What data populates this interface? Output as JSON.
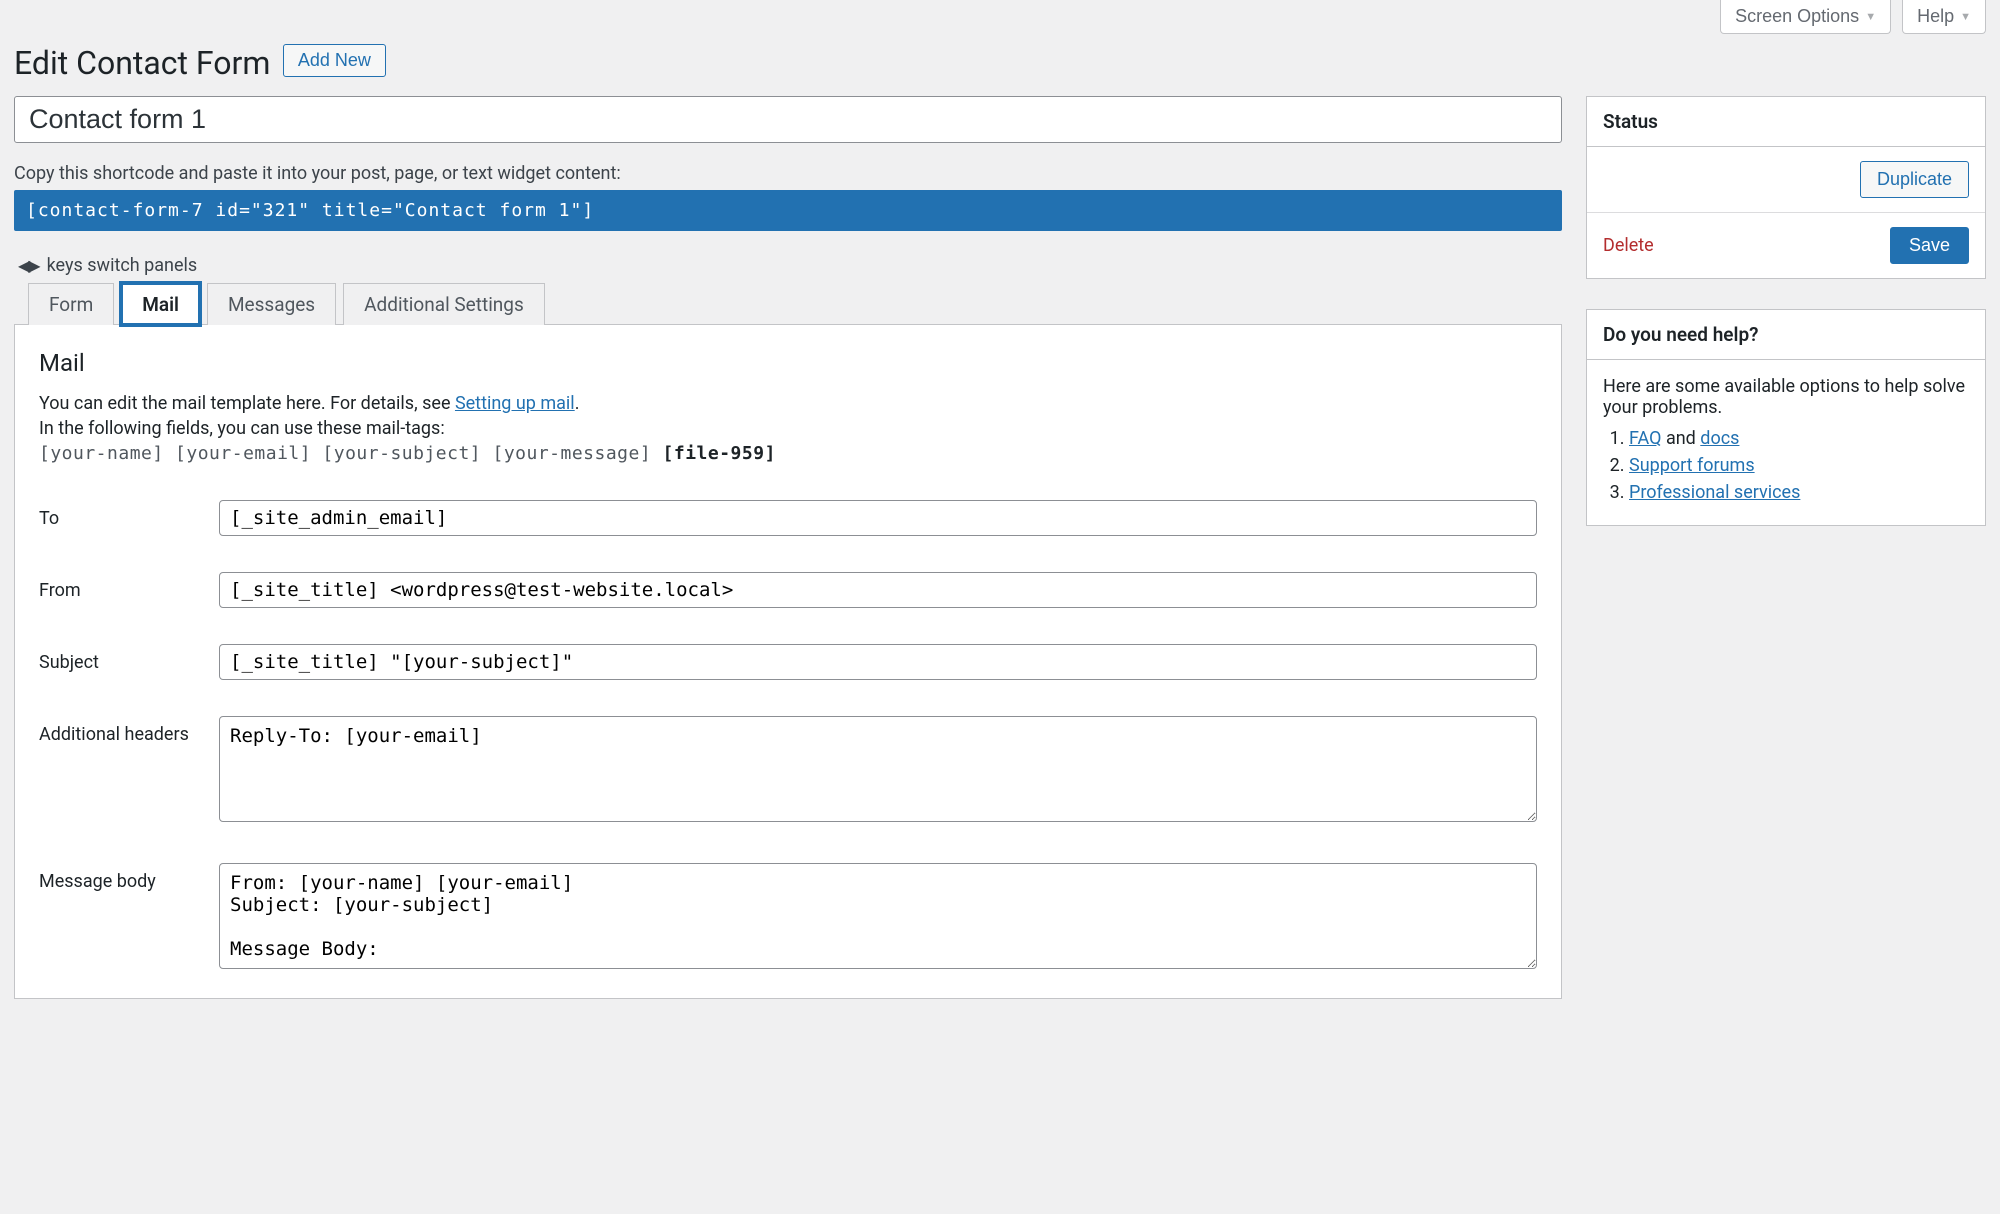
{
  "meta": {
    "screen_options": "Screen Options",
    "help": "Help"
  },
  "header": {
    "title": "Edit Contact Form",
    "add_new": "Add New"
  },
  "form_title": "Contact form 1",
  "shortcode_hint": "Copy this shortcode and paste it into your post, page, or text widget content:",
  "shortcode": "[contact-form-7 id=\"321\" title=\"Contact form 1\"]",
  "keys_hint": "keys switch panels",
  "tabs": {
    "form": "Form",
    "mail": "Mail",
    "messages": "Messages",
    "additional": "Additional Settings"
  },
  "mail_panel": {
    "heading": "Mail",
    "desc1a": "You can edit the mail template here. For details, see ",
    "desc1_link": "Setting up mail",
    "desc1b": ".",
    "desc2": "In the following fields, you can use these mail-tags:",
    "tags_plain": "[your-name] [your-email] [your-subject] [your-message] ",
    "tags_bold": "[file-959]",
    "fields": {
      "to_label": "To",
      "to_value": "[_site_admin_email]",
      "from_label": "From",
      "from_value": "[_site_title] <wordpress@test-website.local>",
      "subject_label": "Subject",
      "subject_value": "[_site_title] \"[your-subject]\"",
      "headers_label": "Additional headers",
      "headers_value": "Reply-To: [your-email]",
      "body_label": "Message body",
      "body_value": "From: [your-name] [your-email]\nSubject: [your-subject]\n\nMessage Body:"
    }
  },
  "status_box": {
    "heading": "Status",
    "duplicate": "Duplicate",
    "delete": "Delete",
    "save": "Save"
  },
  "help_box": {
    "heading": "Do you need help?",
    "intro": "Here are some available options to help solve your problems.",
    "faq": "FAQ",
    "and": " and ",
    "docs": "docs",
    "support": "Support forums",
    "pro": "Professional services"
  }
}
